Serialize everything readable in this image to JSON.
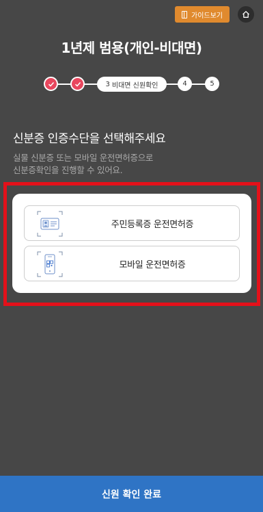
{
  "header": {
    "guide_label": "가이드보기",
    "guide_icon": "book-icon",
    "home_icon": "home-icon",
    "title": "1년제 범용(개인-비대면)"
  },
  "stepper": {
    "completed_steps": 2,
    "current": {
      "number": "3",
      "label": "비대면 신원확인"
    },
    "next_steps": [
      "4",
      "5"
    ],
    "accent_color": "#e8475e"
  },
  "main": {
    "heading": "신분증 인증수단을 선택해주세요",
    "subtext_line1": "실물 신분증 또는 모바일 운전면허증으로",
    "subtext_line2": "신분증확인을 진행할 수 있어요."
  },
  "options": [
    {
      "label": "주민등록증 운전면허증",
      "icon": "id-card-icon"
    },
    {
      "label": "모바일 운전면허증",
      "icon": "mobile-license-icon"
    }
  ],
  "footer": {
    "submit_label": "신원 확인 완료",
    "button_color": "#2f74c5"
  },
  "colors": {
    "background": "#474747",
    "highlight": "#e4111a",
    "guide_button": "#e08a2e"
  }
}
